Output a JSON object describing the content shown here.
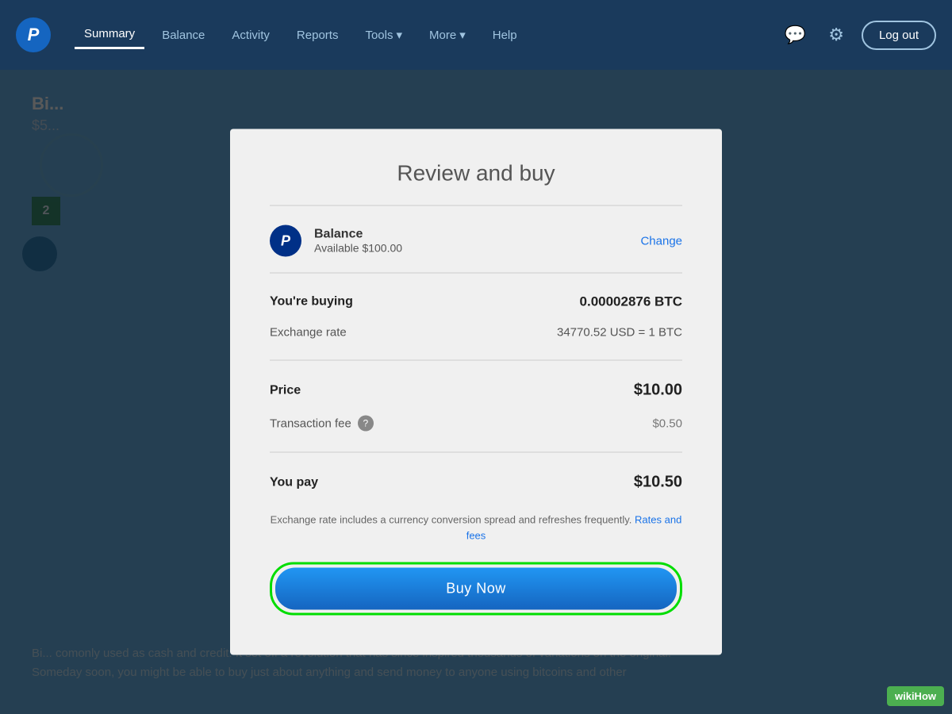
{
  "header": {
    "logo_text": "P",
    "nav_items": [
      {
        "label": "Summary",
        "active": true
      },
      {
        "label": "Balance",
        "active": false
      },
      {
        "label": "Activity",
        "active": false
      },
      {
        "label": "Reports",
        "active": false
      },
      {
        "label": "Tools",
        "active": false,
        "has_dropdown": true
      },
      {
        "label": "More",
        "active": false,
        "has_dropdown": true
      },
      {
        "label": "Help",
        "active": false
      }
    ],
    "logout_label": "Log out"
  },
  "background": {
    "title": "Bi...",
    "subtitle": "$5...",
    "badge_number": "2",
    "body_text": "Bi... comonly used as cash and credit. It set off a revolution that has since inspired thousands of variations on the original. Someday soon, you might be able to buy just about anything and send money to anyone using bitcoins and other"
  },
  "modal": {
    "title": "Review and buy",
    "payment_method": {
      "label": "Balance",
      "available": "Available $100.00",
      "change_label": "Change"
    },
    "you_buying_label": "You're buying",
    "you_buying_value": "0.00002876 BTC",
    "exchange_rate_label": "Exchange rate",
    "exchange_rate_value": "34770.52 USD = 1 BTC",
    "price_label": "Price",
    "price_value": "$10.00",
    "transaction_fee_label": "Transaction fee",
    "transaction_fee_value": "$0.50",
    "you_pay_label": "You pay",
    "you_pay_value": "$10.50",
    "exchange_note_text": "Exchange rate includes a currency conversion spread and refreshes frequently.",
    "rates_fees_link": "Rates and fees",
    "buy_now_label": "Buy Now"
  },
  "wikihow": {
    "label": "wikiHow"
  }
}
